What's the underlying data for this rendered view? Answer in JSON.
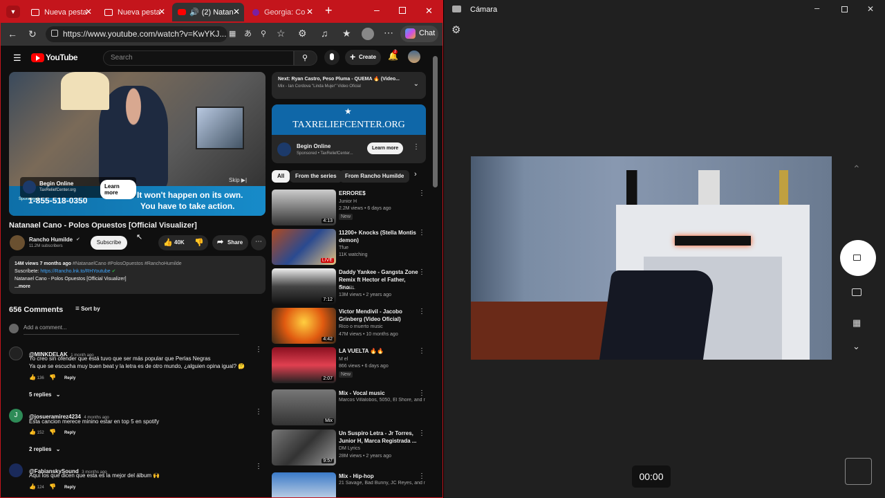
{
  "browser": {
    "tabs": [
      {
        "label": "Nueva pesta"
      },
      {
        "label": "Nueva pesta"
      },
      {
        "label": "(2) Natan"
      },
      {
        "label": "Georgia: Co"
      }
    ],
    "url": "https://www.youtube.com/watch?v=KwYKJ...",
    "chat_label": "Chat"
  },
  "youtube": {
    "logo": "YouTube",
    "search_placeholder": "Search",
    "create_label": "Create",
    "notif_count": "2",
    "ad": {
      "advertiser": "Begin Online",
      "site": "TaxReliefCenter.org",
      "learn_more": "Learn more",
      "skip": "Skip",
      "phone": "1-855-518-0350",
      "line1": "It won't happen on its own.",
      "line2": "You have to take action.",
      "sponsored_prefix": "Sponsored"
    },
    "video_title": "Natanael Cano - Polos Opuestos [Official Visualizer]",
    "channel": "Rancho Humilde",
    "subscribers": "11.2M subscribers",
    "subscribe": "Subscribe",
    "likes": "40K",
    "share": "Share",
    "description": {
      "stats": "14M views  7 months ago",
      "tags": "#NatanaelCano #PolosOpuestos #RanchoHumilde",
      "subscribe_label": "Suscríbete:",
      "subscribe_link": "https://Rancho.lnk.to/RHYoutube",
      "title_line": "Natanael Cano - Polos Opuestos [Official Visualizer]",
      "more": "...more"
    },
    "comments_count": "656 Comments",
    "sort_by": "Sort by",
    "add_comment": "Add a comment...",
    "comments": [
      {
        "author": "@MINKDELAK",
        "time": "1 month ago",
        "text1": "Yo creo sin ofender que está tuvo que ser más popular que Perlas Negras",
        "text2": "Ya que se escucha muy buen beat y la letra es de otro mundo, ¿alguien opina igual? 🤔",
        "likes": "136",
        "reply": "Reply",
        "replies": "5 replies"
      },
      {
        "author": "@josueramirez4234",
        "time": "4 months ago",
        "text1": "Esta cancion merece minino estar en top 5 en spotify",
        "likes": "152",
        "reply": "Reply",
        "replies": "2 replies",
        "avatar_letter": "J"
      },
      {
        "author": "@FabianskySound",
        "time": "3 months ago",
        "text1": "Aquí los que dicen que esta es la mejor del álbum 🙌",
        "likes": "124",
        "reply": "Reply"
      }
    ],
    "next": {
      "title": "Next: Ryan Castro, Peso Pluma - QUEMA 🔥 (Video...",
      "subtitle": "Mix - Ian Cordova \"Linda Mujer\" Video Oficial"
    },
    "side_ad": {
      "banner": "TAXRELIEFCENTER.ORG",
      "advertiser": "Begin Online",
      "sponsored": "Sponsored • TaxReliefCenter...",
      "learn_more": "Learn more"
    },
    "chips": [
      "All",
      "From the series",
      "From Rancho Humilde"
    ],
    "recommendations": [
      {
        "title": "ERRORE$",
        "channel": "Junior H",
        "meta": "2.2M views • 6 days ago",
        "badge": "New",
        "duration": "4:13"
      },
      {
        "title": "11200+ Knocks (Stella Montis demon)",
        "channel": "Tfue",
        "meta": "11K watching",
        "badge": "",
        "duration": "LIVE"
      },
      {
        "title": "Daddy Yankee - Gangsta Zone Remix ft Hector el Father, Sno...",
        "channel": "CHARL",
        "meta": "13M views • 2 years ago",
        "badge": "",
        "duration": "7:12"
      },
      {
        "title": "Victor Mendivil - Jacobo Grinberg (Video Oficial)",
        "channel": "Rico o muerto music",
        "meta": "47M views • 10 months ago",
        "badge": "",
        "duration": "4:42"
      },
      {
        "title": "LA VUELTA 🔥🔥",
        "channel": "M el",
        "meta": "866 views • 6 days ago",
        "badge": "New",
        "duration": "2:07"
      },
      {
        "title": "Mix - Vocal music",
        "channel": "Marcos Villalobos, 5050, El Shore, and m...",
        "meta": "",
        "badge": "",
        "duration": "Mix"
      },
      {
        "title": "Un Suspiro Letra - Jr Torres, Junior H, Marca Registrada ...",
        "channel": "DM Lyrics",
        "meta": "28M views • 2 years ago",
        "badge": "",
        "duration": "9:57"
      },
      {
        "title": "Mix - Hip-hop",
        "channel": "21 Savage, Bad Bunny, JC Reyes, and mo...",
        "meta": "",
        "badge": "",
        "duration": ""
      }
    ]
  },
  "camera": {
    "title": "Cámara",
    "timer": "00:00"
  }
}
